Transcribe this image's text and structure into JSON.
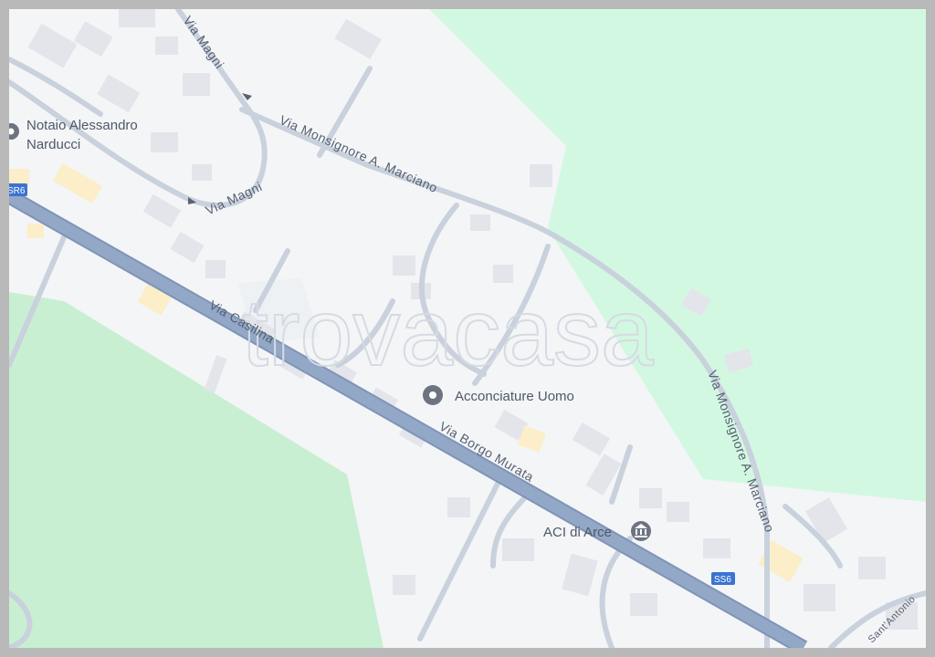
{
  "map": {
    "watermark": "trovacasa",
    "streets": {
      "via_magni_top": "Via Magni",
      "via_magni_bottom": "Via Magni",
      "via_monsignore_top": "Via Monsignore A. Marciano",
      "via_monsignore_right": "Via Monsignore A. Marciano",
      "via_casilina": "Via Casilina",
      "via_borgo_murata": "Via Borgo Murata",
      "sant_antonio": "Sant'Antonio"
    },
    "shields": {
      "sr6": "SR6",
      "ss6": "SS6"
    },
    "pois": [
      {
        "name_line1": "Notaio Alessandro",
        "name_line2": "Narducci",
        "icon": "location-pin-icon"
      },
      {
        "name": "Acconciature Uomo",
        "icon": "location-pin-icon"
      },
      {
        "name": "ACI di Arce",
        "icon": "bank-icon"
      }
    ],
    "colors": {
      "land": "#f4f5f7",
      "park": "#d3f8e2",
      "green": "#c9f0cf",
      "main_road": "#8fa4c4",
      "minor_road": "#c8d0dc",
      "building": "#e4e6ea",
      "highlight_building": "#fcefc9",
      "shield": "#3b74d0",
      "label": "#5a6270"
    }
  }
}
